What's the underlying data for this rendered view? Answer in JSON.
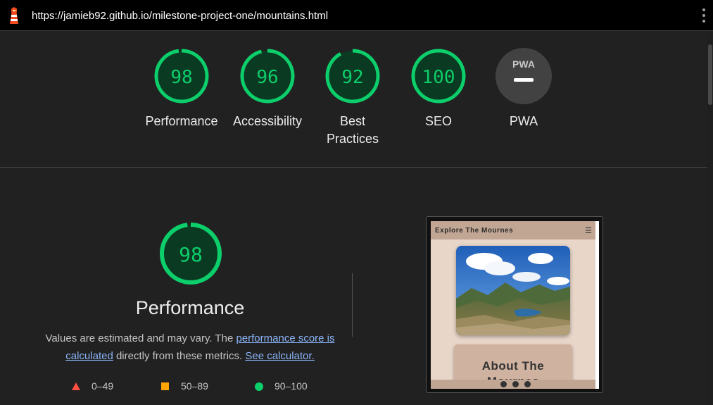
{
  "address_bar": {
    "url": "https://jamieb92.github.io/milestone-project-one/mountains.html",
    "icon": "lighthouse-icon",
    "menu_icon": "kebab-menu-icon"
  },
  "gauges": [
    {
      "score": "98",
      "label": "Performance"
    },
    {
      "score": "96",
      "label": "Accessibility"
    },
    {
      "score": "92",
      "label": "Best Practices",
      "label_line1": "Best",
      "label_line2": "Practices"
    },
    {
      "score": "100",
      "label": "SEO"
    },
    {
      "score": "",
      "label": "PWA",
      "badge": "PWA"
    }
  ],
  "performance": {
    "score": "98",
    "title": "Performance",
    "desc_part1": "Values are estimated and may vary. The ",
    "link1": "performance score is calculated",
    "desc_part2": " directly from these metrics. ",
    "link2": "See calculator."
  },
  "legend": [
    {
      "range": "0–49",
      "color": "#ff4e42",
      "shape": "triangle"
    },
    {
      "range": "50–89",
      "color": "#ffa400",
      "shape": "square"
    },
    {
      "range": "90–100",
      "color": "#0cce6b",
      "shape": "circle"
    }
  ],
  "screenshot": {
    "brand": "Explore The Mournes",
    "menu_icon": "hamburger-icon",
    "card_title_line1": "About The",
    "card_title_line2": "Mournes",
    "social_icons": [
      "facebook-icon",
      "twitter-icon",
      "instagram-icon"
    ]
  },
  "colors": {
    "pass": "#0cce6b",
    "pass_bg": "#0b3a22",
    "background": "#212121",
    "link": "#8ab4f8"
  }
}
